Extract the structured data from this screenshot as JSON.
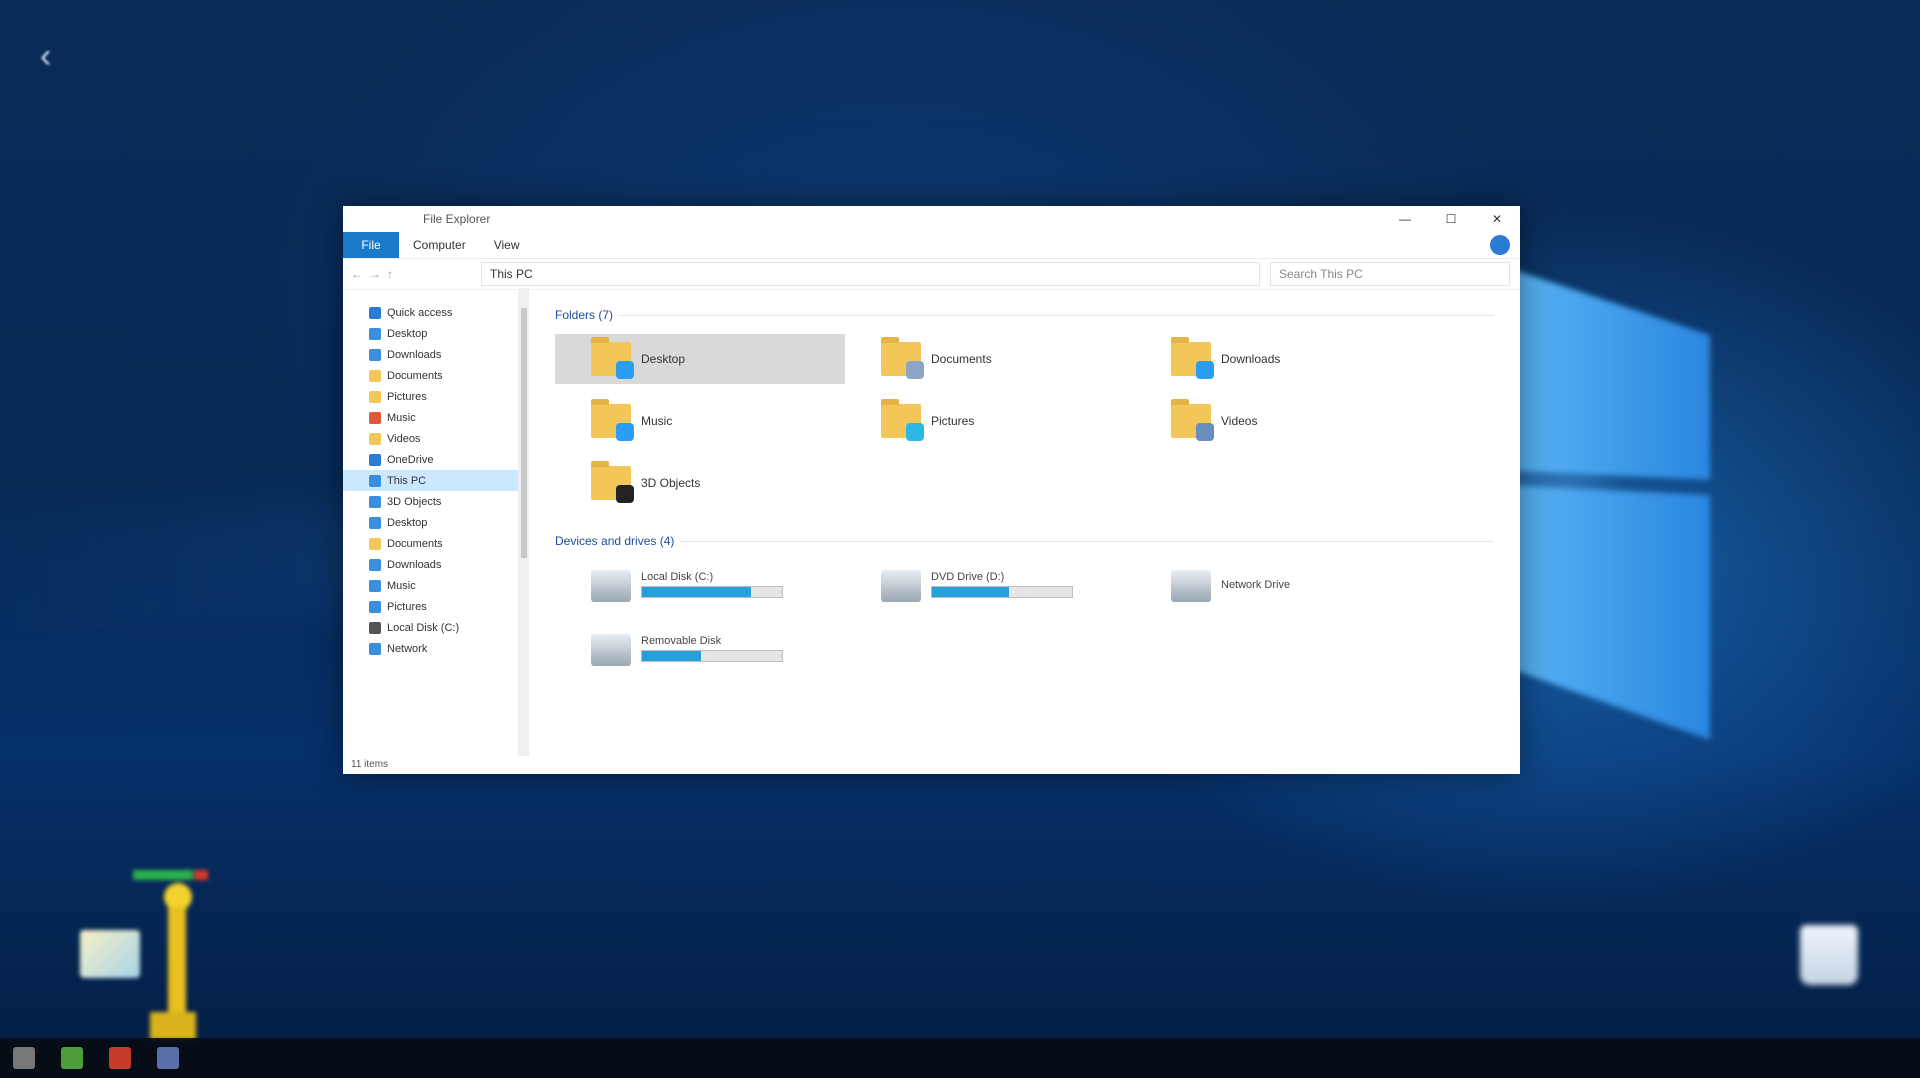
{
  "window": {
    "title": "File Explorer",
    "minimize_glyph": "—",
    "maximize_glyph": "☐",
    "close_glyph": "✕",
    "ribbon": {
      "file_tab": "File",
      "tabs": [
        "Computer",
        "View"
      ]
    },
    "address": {
      "path": "This PC",
      "search_placeholder": "Search This PC"
    },
    "nav_pane": {
      "items": [
        {
          "label": "Quick access",
          "icon": "star-icon",
          "color": "#2a7bd4"
        },
        {
          "label": "Desktop",
          "icon": "desktop-icon",
          "color": "#3a8ee0"
        },
        {
          "label": "Downloads",
          "icon": "download-icon",
          "color": "#3a8ee0"
        },
        {
          "label": "Documents",
          "icon": "documents-icon",
          "color": "#f3c65a"
        },
        {
          "label": "Pictures",
          "icon": "pictures-icon",
          "color": "#f3c65a"
        },
        {
          "label": "Music",
          "icon": "music-icon",
          "color": "#e0563a"
        },
        {
          "label": "Videos",
          "icon": "video-icon",
          "color": "#f3c65a"
        },
        {
          "label": "OneDrive",
          "icon": "cloud-icon",
          "color": "#2a7bd4"
        },
        {
          "label": "This PC",
          "icon": "computer-icon",
          "color": "#3a8ee0",
          "selected": true
        },
        {
          "label": "3D Objects",
          "icon": "cube-icon",
          "color": "#3a8ee0"
        },
        {
          "label": "Desktop",
          "icon": "desktop-icon",
          "color": "#3a8ee0"
        },
        {
          "label": "Documents",
          "icon": "documents-icon",
          "color": "#f3c65a"
        },
        {
          "label": "Downloads",
          "icon": "download-icon",
          "color": "#3a8ee0"
        },
        {
          "label": "Music",
          "icon": "music-icon",
          "color": "#3a8ee0"
        },
        {
          "label": "Pictures",
          "icon": "pictures-icon",
          "color": "#3a8ee0"
        },
        {
          "label": "Local Disk (C:)",
          "icon": "drive-icon",
          "color": "#555555"
        },
        {
          "label": "Network",
          "icon": "network-icon",
          "color": "#3a8ee0"
        }
      ]
    },
    "folders_group": {
      "title": "Folders (7)",
      "items": [
        {
          "label": "Desktop",
          "badge_color": "#2a9df4",
          "selected": true
        },
        {
          "label": "Documents",
          "badge_color": "#8aa6c4"
        },
        {
          "label": "Downloads",
          "badge_color": "#2a9df4"
        },
        {
          "label": "Music",
          "badge_color": "#2a9df4"
        },
        {
          "label": "Pictures",
          "badge_color": "#2ab8e6"
        },
        {
          "label": "Videos",
          "badge_color": "#6a8fbf"
        },
        {
          "label": "3D Objects",
          "badge_color": "#222222"
        }
      ]
    },
    "drives_group": {
      "title": "Devices and drives (4)",
      "items": [
        {
          "label": "Local Disk (C:)",
          "free": "",
          "used_fraction": 0.78
        },
        {
          "label": "DVD Drive (D:)",
          "free": "",
          "used_fraction": 0.55
        },
        {
          "label": "Network Drive",
          "free": "",
          "used_fraction": 0.0
        },
        {
          "label": "Removable Disk",
          "free": "",
          "used_fraction": 0.42
        }
      ]
    },
    "status": "11 items"
  },
  "desktop": {
    "back_glyph": "‹"
  },
  "colors": {
    "accent": "#1979ca",
    "wallpaper_dark": "#06234a"
  }
}
